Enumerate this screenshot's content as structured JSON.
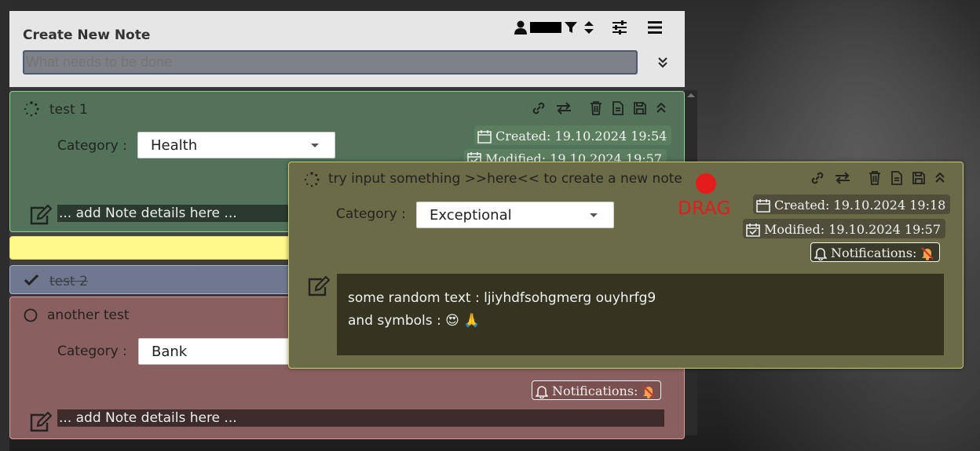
{
  "header": {
    "title": "Create New Note",
    "input_placeholder": "What needs to be done",
    "toolbar_icons": [
      "user-icon",
      "filter-icon",
      "sort-icon",
      "sliders-icon",
      "menu-icon"
    ],
    "expand_icon": "double-chevron-down-icon"
  },
  "notes": [
    {
      "title": "test 1",
      "category_label": "Category :",
      "category": "Health",
      "created": "Created: 19.10.2024 19:54",
      "modified": "Modified: 19.10.2024 19:57",
      "details_placeholder": "... add Note details here ...",
      "color": "#52735a"
    },
    {
      "title": "",
      "color": "#fff88a"
    },
    {
      "title": "test 2",
      "completed": true,
      "color": "#707890"
    },
    {
      "title": "another test",
      "category_label": "Category :",
      "category": "Bank",
      "notifications": "Notifications:",
      "details_placeholder": "... add Note details here ...",
      "color": "#8a5f5f"
    }
  ],
  "dragged_note": {
    "title": "try input something >>here<< to create a new note",
    "category_label": "Category :",
    "category": "Exceptional",
    "created": "Created: 19.10.2024 19:18",
    "modified": "Modified: 19.10.2024 19:57",
    "notifications": "Notifications:",
    "body_line1": "some random text : ljiyhdfsohgmerg ouyhrfg9",
    "body_line2": "and symbols : 😍 🙏",
    "drag_label": "DRAG",
    "color": "#6b6b47"
  }
}
